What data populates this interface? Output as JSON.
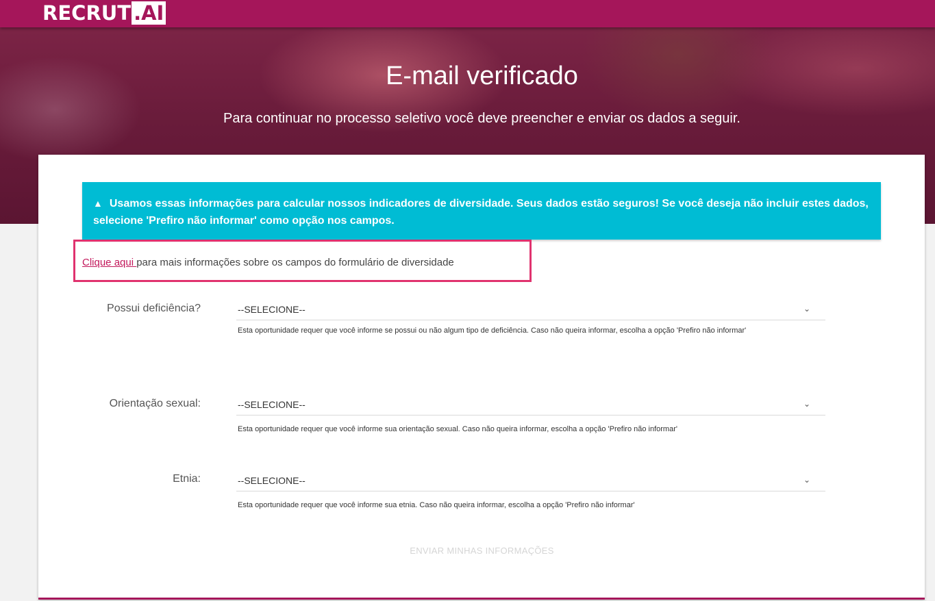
{
  "header": {
    "logo_prefix": "RECRUT",
    "logo_box": ".AI"
  },
  "hero": {
    "title": "E-mail verificado",
    "subtitle": "Para continuar no processo seletivo você deve preencher e enviar os dados a seguir."
  },
  "alert": {
    "icon": "warning-triangle-icon",
    "icon_glyph": "▲",
    "text": "Usamos essas informações para calcular nossos indicadores de diversidade. Seus dados estão seguros! Se você deseja não incluir estes dados, selecione 'Prefiro não informar' como opção nos campos."
  },
  "more_info": {
    "link_text": "Clique aqui ",
    "text": "para mais informações sobre os campos do formulário de diversidade"
  },
  "fields": [
    {
      "label": "Possui deficiência?",
      "value": "--SELECIONE--",
      "help": "Esta oportunidade requer que você informe se possui ou não algum tipo de deficiência. Caso não queira informar, escolha a opção 'Prefiro não informar'"
    },
    {
      "label": "Orientação sexual:",
      "value": "--SELECIONE--",
      "help": "Esta oportunidade requer que você informe sua orientação sexual. Caso não queira informar, escolha a opção 'Prefiro não informar'"
    },
    {
      "label": "Etnia:",
      "value": "--SELECIONE--",
      "help": "Esta oportunidade requer que você informe sua etnia. Caso não queira informar, escolha a opção 'Prefiro não informar'"
    }
  ],
  "chevron_glyph": "⌄",
  "submit_label": "ENVIAR MINHAS INFORMAÇÕES",
  "colors": {
    "brand": "#a5165a",
    "alert": "#00bcd4",
    "highlight": "#e0326e"
  }
}
